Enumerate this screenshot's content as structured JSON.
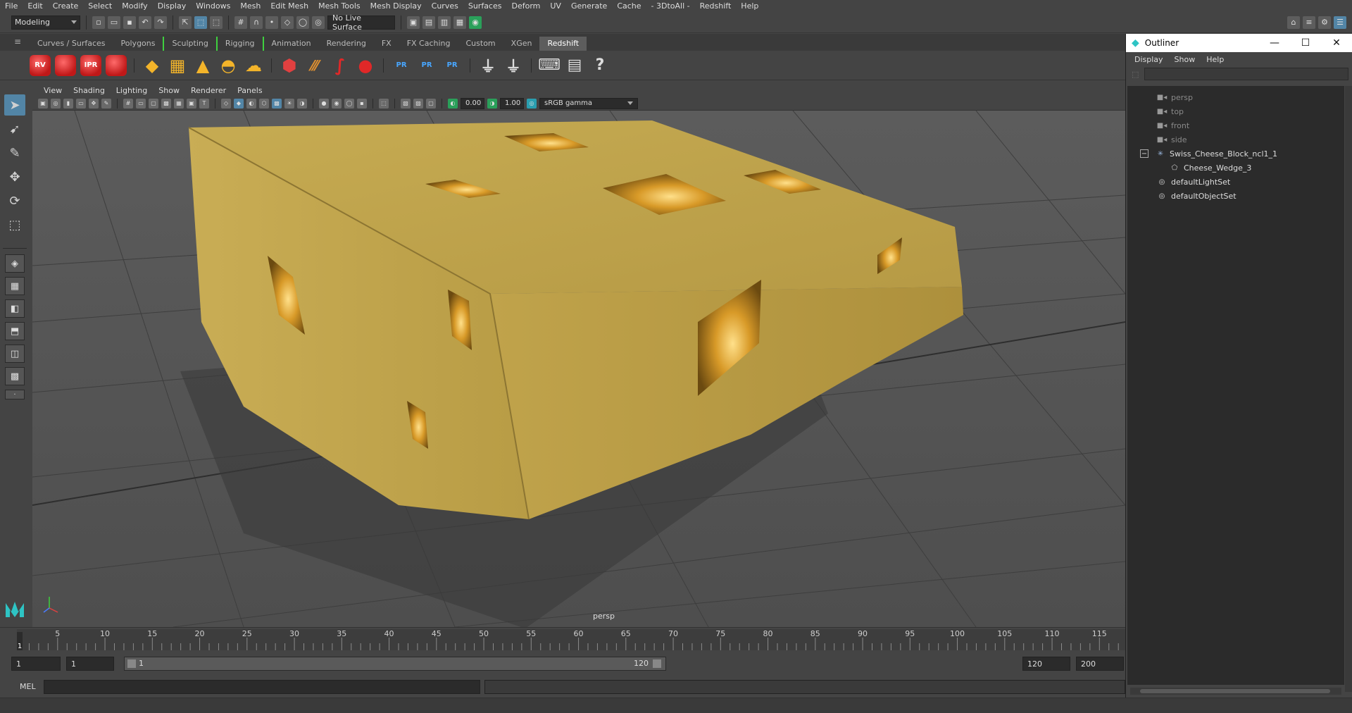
{
  "menubar": [
    "File",
    "Edit",
    "Create",
    "Select",
    "Modify",
    "Display",
    "Windows",
    "Mesh",
    "Edit Mesh",
    "Mesh Tools",
    "Mesh Display",
    "Curves",
    "Surfaces",
    "Deform",
    "UV",
    "Generate",
    "Cache",
    "- 3DtoAll -",
    "Redshift",
    "Help"
  ],
  "status": {
    "workspace": "Modeling",
    "live_surface": "No Live Surface"
  },
  "shelf_tabs": [
    "Curves / Surfaces",
    "Polygons",
    "Sculpting",
    "Rigging",
    "Animation",
    "Rendering",
    "FX",
    "FX Caching",
    "Custom",
    "XGen",
    "Redshift"
  ],
  "active_shelf_tab": "Redshift",
  "shelf": {
    "rs_labels": [
      "RV",
      "",
      "IPR",
      ""
    ],
    "pr_labels": [
      "PR",
      "PR",
      "PR"
    ]
  },
  "panel_menu": [
    "View",
    "Shading",
    "Lighting",
    "Show",
    "Renderer",
    "Panels"
  ],
  "panel_toolbar": {
    "exposure": "0.00",
    "gamma": "1.00",
    "colorspace": "sRGB gamma"
  },
  "viewport": {
    "camera": "persp",
    "object_color": "#c7a94c"
  },
  "timeline": {
    "ticks": [
      "5",
      "10",
      "15",
      "20",
      "25",
      "30",
      "35",
      "40",
      "45",
      "50",
      "55",
      "60",
      "65",
      "70",
      "75",
      "80",
      "85",
      "90",
      "95",
      "100",
      "105",
      "110",
      "115"
    ],
    "current_frame": "1"
  },
  "range": {
    "start": "1",
    "current": "1",
    "slider_start": "1",
    "slider_end": "120",
    "end": "120",
    "anim_end": "200"
  },
  "cmdline": {
    "label": "MEL"
  },
  "outliner": {
    "title": "Outliner",
    "menu": [
      "Display",
      "Show",
      "Help"
    ],
    "items": [
      {
        "label": "persp",
        "kind": "camera"
      },
      {
        "label": "top",
        "kind": "camera"
      },
      {
        "label": "front",
        "kind": "camera"
      },
      {
        "label": "side",
        "kind": "camera"
      },
      {
        "label": "Swiss_Cheese_Block_ncl1_1",
        "kind": "group"
      },
      {
        "label": "Cheese_Wedge_3",
        "kind": "mesh"
      },
      {
        "label": "defaultLightSet",
        "kind": "set"
      },
      {
        "label": "defaultObjectSet",
        "kind": "set"
      }
    ]
  }
}
